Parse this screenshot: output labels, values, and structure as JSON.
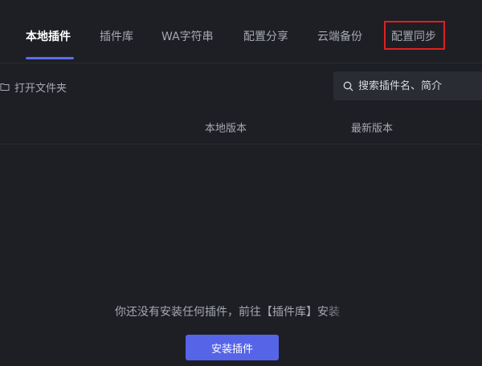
{
  "tabs": [
    {
      "label": "本地插件",
      "active": true
    },
    {
      "label": "插件库",
      "active": false
    },
    {
      "label": "WA字符串",
      "active": false
    },
    {
      "label": "配置分享",
      "active": false
    },
    {
      "label": "云端备份",
      "active": false
    },
    {
      "label": "配置同步",
      "active": false
    }
  ],
  "toolbar": {
    "open_folder_label": "打开文件夹",
    "search_placeholder": "搜索插件名、简介"
  },
  "table": {
    "columns": [
      "本地版本",
      "最新版本"
    ]
  },
  "empty_state": {
    "message": "你还没有安装任何插件，前往【插件库】安装",
    "install_button_label": "安装插件"
  },
  "colors": {
    "background": "#1e1f24",
    "accent": "#5b6cf0",
    "highlight_box": "#e02020"
  }
}
